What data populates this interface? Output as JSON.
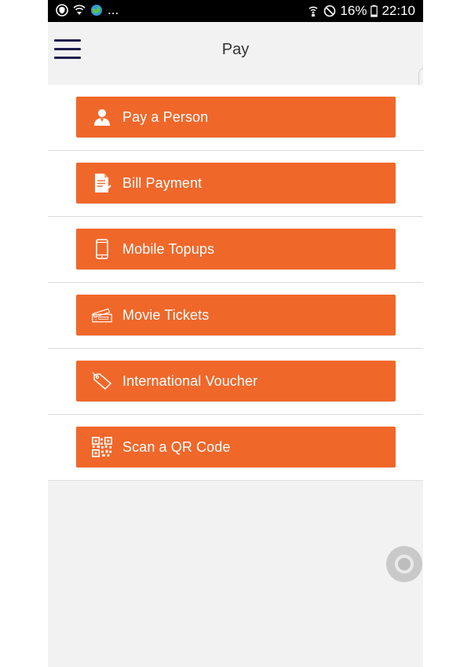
{
  "status_bar": {
    "left_icons": [
      "shield-icon",
      "wifi-shield-icon",
      "globe-icon"
    ],
    "ellipsis": "...",
    "right_icons": [
      "wifi-call-icon",
      "do-not-disturb-icon"
    ],
    "battery": "16%",
    "time": "22:10"
  },
  "app_bar": {
    "menu_icon": "hamburger-menu-icon",
    "title": "Pay"
  },
  "pay_options": [
    {
      "label": "Pay a Person",
      "icon": "person-icon"
    },
    {
      "label": "Bill Payment",
      "icon": "bill-document-icon"
    },
    {
      "label": "Mobile Topups",
      "icon": "mobile-phone-icon"
    },
    {
      "label": "Movie Tickets",
      "icon": "ticket-icon"
    },
    {
      "label": "International Voucher",
      "icon": "voucher-tag-icon"
    },
    {
      "label": "Scan a QR Code",
      "icon": "qr-code-icon"
    }
  ],
  "colors": {
    "button": "#f0672a",
    "menu_icon": "#1f1d4f",
    "background": "#f2f2f2"
  }
}
